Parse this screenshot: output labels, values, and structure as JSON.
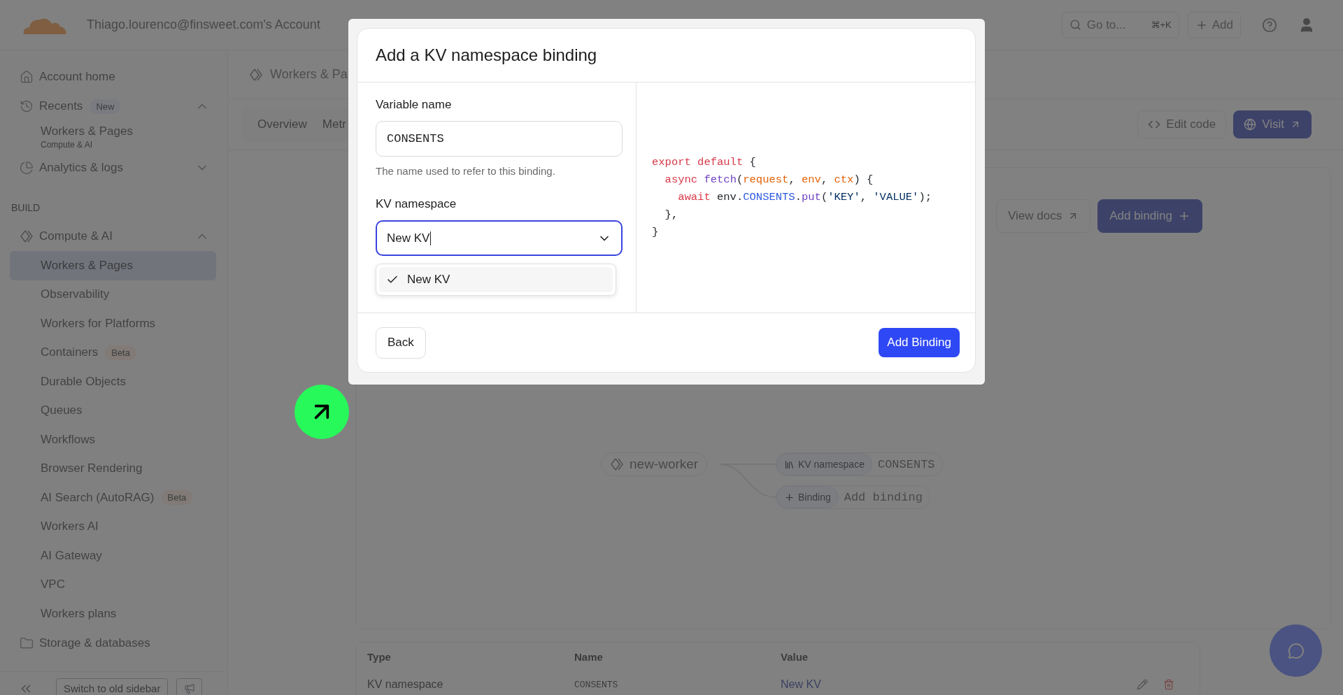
{
  "topbar": {
    "account": "Thiago.lourenco@finsweet.com's Account",
    "search": {
      "placeholder": "Go to...",
      "shortcut": "⌘+K"
    },
    "add_button": "Add"
  },
  "sidebar": {
    "items": [
      {
        "kind": "link",
        "label": "Account home"
      },
      {
        "kind": "group",
        "label": "Recents",
        "badge": {
          "text": "New",
          "kind": "new"
        },
        "expanded": true,
        "children": [
          {
            "kind": "recent",
            "label": "Workers & Pages",
            "subtitle": "Compute & AI",
            "selected": false
          }
        ]
      },
      {
        "kind": "group",
        "label": "Analytics & logs",
        "expanded": false
      },
      {
        "kind": "heading",
        "label": "BUILD"
      },
      {
        "kind": "group",
        "label": "Compute & AI",
        "expanded": true,
        "children": [
          {
            "kind": "child",
            "label": "Workers & Pages",
            "selected": true
          },
          {
            "kind": "child",
            "label": "Observability",
            "selected": false
          },
          {
            "kind": "child",
            "label": "Workers for Platforms",
            "selected": false
          },
          {
            "kind": "child",
            "label": "Containers",
            "badge": {
              "text": "Beta",
              "kind": "beta"
            },
            "selected": false
          },
          {
            "kind": "child",
            "label": "Durable Objects",
            "selected": false
          },
          {
            "kind": "child",
            "label": "Queues",
            "selected": false
          },
          {
            "kind": "child",
            "label": "Workflows",
            "selected": false
          },
          {
            "kind": "child",
            "label": "Browser Rendering",
            "selected": false
          },
          {
            "kind": "child",
            "label": "AI Search (AutoRAG)",
            "badge": {
              "text": "Beta",
              "kind": "beta"
            },
            "selected": false
          },
          {
            "kind": "child",
            "label": "Workers AI",
            "selected": false
          },
          {
            "kind": "child",
            "label": "AI Gateway",
            "selected": false
          },
          {
            "kind": "child",
            "label": "VPC",
            "selected": false
          },
          {
            "kind": "child",
            "label": "Workers plans",
            "selected": false
          }
        ]
      },
      {
        "kind": "group",
        "label": "Storage & databases"
      }
    ],
    "footer": {
      "switch_button": "Switch to old sidebar"
    }
  },
  "main": {
    "breadcrumb": "Workers & Pa",
    "tabs": [
      {
        "label": "Overview",
        "selected": false
      },
      {
        "label": "Metr",
        "selected": false
      }
    ],
    "edit_code": "Edit code",
    "visit": "Visit",
    "view_docs": "View docs",
    "add_binding": "Add binding",
    "diagram": {
      "worker": "new-worker",
      "bindings": [
        {
          "kind": "kv",
          "type": "KV namespace",
          "value": "CONSENTS"
        },
        {
          "kind": "add",
          "type": "Binding",
          "value": "Add binding"
        }
      ]
    },
    "table": {
      "columns": [
        "Type",
        "Name",
        "Value"
      ],
      "rows": [
        {
          "type": "KV namespace",
          "name": "CONSENTS",
          "value": "New KV"
        }
      ]
    }
  },
  "modal": {
    "title": "Add a KV namespace binding",
    "variable_label": "Variable name",
    "variable_value": "CONSENTS",
    "variable_hint": "The name used to refer to this binding.",
    "namespace_label": "KV namespace",
    "namespace_value": "New KV",
    "namespace_focused": true,
    "options": [
      {
        "label": "New KV",
        "selected": true
      }
    ],
    "code": [
      [
        {
          "kind": "keyword",
          "text": "export default"
        },
        {
          "kind": "plain",
          "text": " {"
        }
      ],
      [
        {
          "kind": "keyword",
          "text": "  async "
        },
        {
          "kind": "fn",
          "text": "fetch"
        },
        {
          "kind": "plain",
          "text": "("
        },
        {
          "kind": "param",
          "text": "request"
        },
        {
          "kind": "plain",
          "text": ", "
        },
        {
          "kind": "param",
          "text": "env"
        },
        {
          "kind": "plain",
          "text": ", "
        },
        {
          "kind": "param",
          "text": "ctx"
        },
        {
          "kind": "plain",
          "text": ") {"
        }
      ],
      [
        {
          "kind": "keyword",
          "text": "    await"
        },
        {
          "kind": "plain",
          "text": " env."
        },
        {
          "kind": "prop",
          "text": "CONSENTS"
        },
        {
          "kind": "plain",
          "text": "."
        },
        {
          "kind": "fn",
          "text": "put"
        },
        {
          "kind": "plain",
          "text": "("
        },
        {
          "kind": "string",
          "text": "'KEY'"
        },
        {
          "kind": "plain",
          "text": ", "
        },
        {
          "kind": "string",
          "text": "'VALUE'"
        },
        {
          "kind": "plain",
          "text": ");"
        }
      ],
      [
        {
          "kind": "plain",
          "text": "  },"
        }
      ],
      [
        {
          "kind": "plain",
          "text": "}"
        }
      ]
    ],
    "back_button": "Back",
    "submit_button": "Add Binding"
  }
}
